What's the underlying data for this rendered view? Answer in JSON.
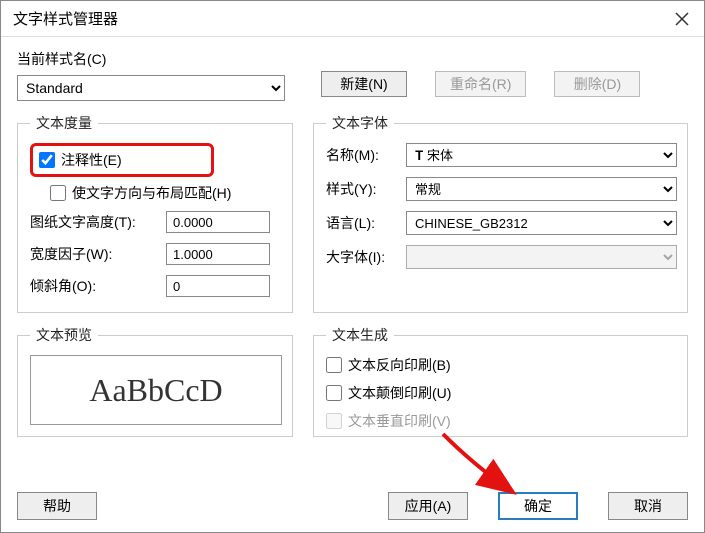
{
  "window": {
    "title": "文字样式管理器"
  },
  "style_name": {
    "label": "当前样式名(C)",
    "value": "Standard"
  },
  "buttons": {
    "new": "新建(N)",
    "rename": "重命名(R)",
    "delete": "删除(D)",
    "help": "帮助",
    "apply": "应用(A)",
    "ok": "确定",
    "cancel": "取消"
  },
  "metrics": {
    "legend": "文本度量",
    "annotative": "注释性(E)",
    "match_orientation": "使文字方向与布局匹配(H)",
    "text_height_label": "图纸文字高度(T):",
    "text_height_value": "0.0000",
    "width_factor_label": "宽度因子(W):",
    "width_factor_value": "1.0000",
    "oblique_label": "倾斜角(O):",
    "oblique_value": "0"
  },
  "font": {
    "legend": "文本字体",
    "name_label": "名称(M):",
    "name_value": "宋体",
    "style_label": "样式(Y):",
    "style_value": "常规",
    "lang_label": "语言(L):",
    "lang_value": "CHINESE_GB2312",
    "bigfont_label": "大字体(I):",
    "bigfont_value": ""
  },
  "preview": {
    "legend": "文本预览",
    "sample": "AaBbCcD"
  },
  "generate": {
    "legend": "文本生成",
    "backwards": "文本反向印刷(B)",
    "upside": "文本颠倒印刷(U)",
    "vertical": "文本垂直印刷(V)"
  }
}
